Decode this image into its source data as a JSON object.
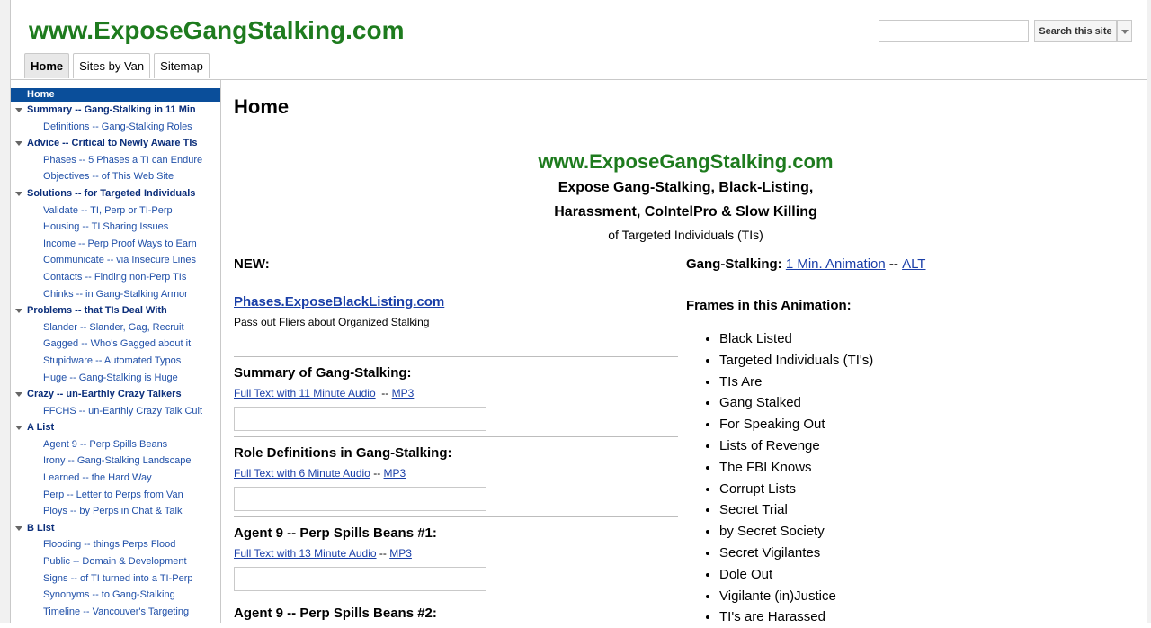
{
  "header": {
    "site_title": "www.ExposeGangStalking.com",
    "tabs": [
      {
        "label": "Home",
        "active": true
      },
      {
        "label": "Sites by Van",
        "active": false
      },
      {
        "label": "Sitemap",
        "active": false
      }
    ],
    "search": {
      "placeholder": "",
      "button_label": "Search this site"
    }
  },
  "sidebar": {
    "home_label": "Home",
    "groups": [
      {
        "label": "Summary -- Gang-Stalking in 11 Min",
        "items": [
          "Definitions -- Gang-Stalking Roles"
        ]
      },
      {
        "label": "Advice -- Critical to Newly Aware TIs",
        "items": [
          "Phases -- 5 Phases a TI can Endure",
          "Objectives -- of This Web Site"
        ]
      },
      {
        "label": "Solutions -- for Targeted Individuals",
        "items": [
          "Validate -- TI, Perp or TI-Perp",
          "Housing -- TI Sharing Issues",
          "Income -- Perp Proof Ways to Earn",
          "Communicate -- via Insecure Lines",
          "Contacts -- Finding non-Perp TIs",
          "Chinks -- in Gang-Stalking Armor"
        ]
      },
      {
        "label": "Problems -- that TIs Deal With",
        "items": [
          "Slander -- Slander, Gag, Recruit",
          "Gagged -- Who's Gagged about it",
          "Stupidware -- Automated Typos",
          "Huge -- Gang-Stalking is Huge"
        ]
      },
      {
        "label": "Crazy -- un-Earthly Crazy Talkers",
        "items": [
          "FFCHS -- un-Earthly Crazy Talk Cult"
        ]
      },
      {
        "label": "A List",
        "items": [
          "Agent 9 -- Perp Spills Beans",
          "Irony -- Gang-Stalking Landscape",
          "Learned -- the Hard Way",
          "Perp -- Letter to Perps from Van",
          "Ploys -- by Perps in Chat & Talk"
        ]
      },
      {
        "label": "B List",
        "items": [
          "Flooding -- things Perps Flood",
          "Public -- Domain & Development",
          "Signs -- of TI turned into a TI-Perp",
          "Synonyms -- to Gang-Stalking",
          "Timeline -- Vancouver's Targeting"
        ]
      }
    ]
  },
  "main": {
    "page_title": "Home",
    "center": {
      "site": "www.ExposeGangStalking.com",
      "line1": "Expose Gang-Stalking, Black-Listing,",
      "line2": "Harassment, CoIntelPro & Slow Killing",
      "line3": "of Targeted Individuals (TIs)"
    },
    "left": {
      "new_label": "NEW:",
      "phases_link": "Phases.ExposeBlackListing.com",
      "phases_sub": "Pass out Fliers about Organized Stalking",
      "sections": [
        {
          "title": "Summary of Gang-Stalking:",
          "link": "Full Text with 11 Minute Audio",
          "sep": "  -- ",
          "mp3": "MP3"
        },
        {
          "title": "Role Definitions in Gang-Stalking:",
          "link": "Full Text with 6 Minute Audio",
          "sep": " -- ",
          "mp3": "MP3"
        },
        {
          "title": "Agent 9 -- Perp Spills Beans #1:",
          "link": "Full Text with 13 Minute Audio",
          "sep": " -- ",
          "mp3": "MP3"
        },
        {
          "title": "Agent 9 -- Perp Spills Beans #2:"
        }
      ]
    },
    "right": {
      "gs_label": "Gang-Stalking:",
      "gs_link": "1 Min. Animation",
      "gs_sep": "--",
      "gs_alt": "ALT",
      "frames_title": "Frames in this Animation:",
      "frames": [
        "Black Listed",
        "Targeted Individuals (TI's)",
        "TIs Are",
        "Gang Stalked",
        "For Speaking Out",
        "Lists of Revenge",
        "The FBI Knows",
        "Corrupt Lists",
        "Secret Trial",
        "by Secret Society",
        "Secret Vigilantes",
        "Dole Out",
        "Vigilante (in)Justice",
        "TI's are Harassed"
      ]
    }
  }
}
